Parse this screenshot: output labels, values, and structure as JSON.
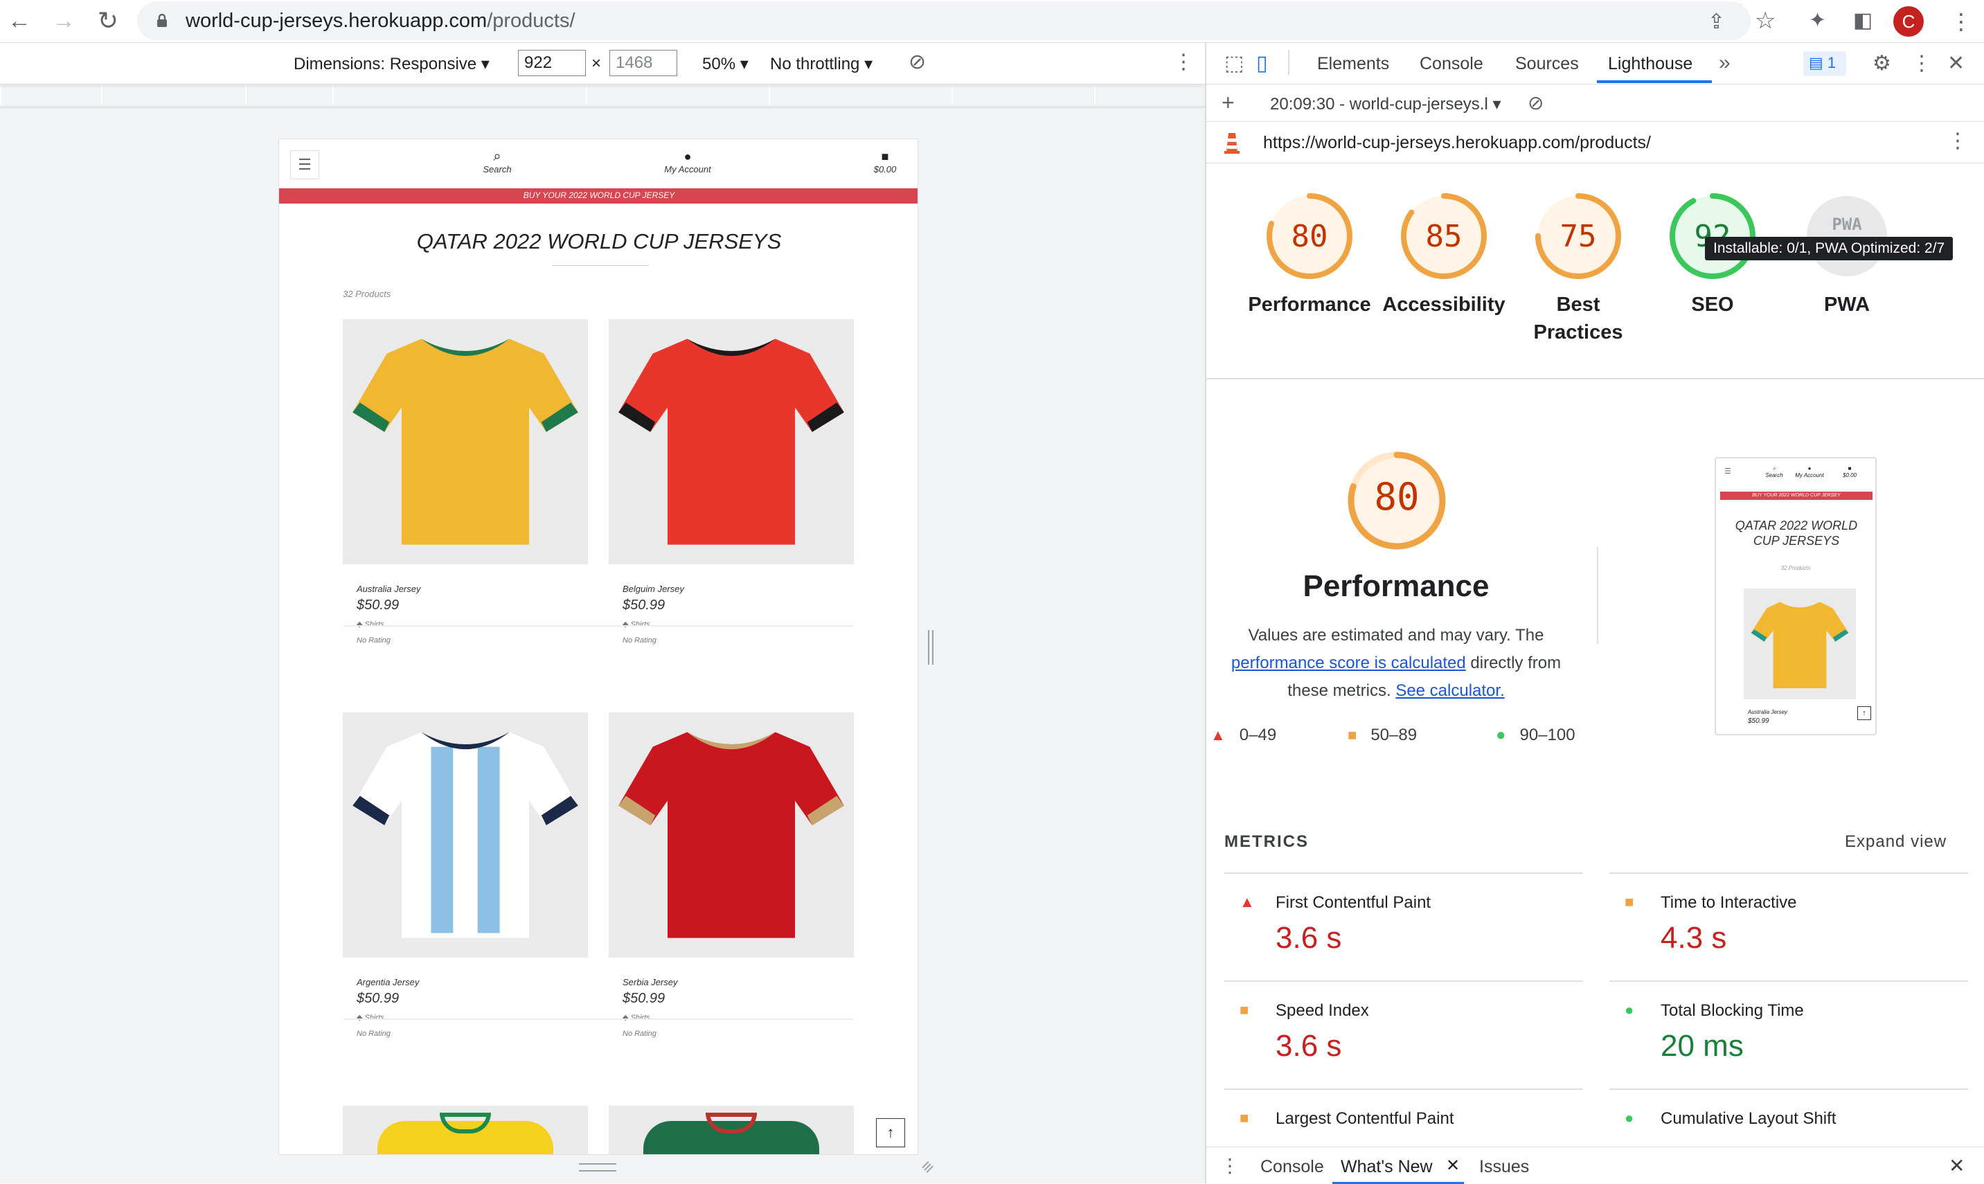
{
  "browser": {
    "url_host": "world-cup-jerseys.herokuapp.com",
    "url_path": "/products/",
    "avatar_letter": "C"
  },
  "device_toolbar": {
    "dimensions_label": "Dimensions: Responsive",
    "width": "922",
    "height": "1468",
    "zoom": "50%",
    "throttling": "No throttling"
  },
  "site": {
    "nav_search": "Search",
    "nav_account": "My Account",
    "nav_cart": "$0.00",
    "banner": "BUY YOUR 2022 WORLD CUP JERSEY",
    "page_title": "QATAR 2022 WORLD CUP JERSEYS",
    "product_count": "32 Products",
    "products": [
      {
        "name": "Australia Jersey",
        "price": "$50.99",
        "tag": "Shirts",
        "rating": "No Rating",
        "colors": [
          "#f2b731",
          "#e9c14a",
          "#1e7a4a"
        ]
      },
      {
        "name": "Belguim Jersey",
        "price": "$50.99",
        "tag": "Shirts",
        "rating": "No Rating",
        "colors": [
          "#e8362c",
          "#d42a22",
          "#1a1a1a"
        ]
      },
      {
        "name": "Argentia Jersey",
        "price": "$50.99",
        "tag": "Shirts",
        "rating": "No Rating",
        "colors": [
          "#ffffff",
          "#8cc0e6",
          "#1c2a4a"
        ]
      },
      {
        "name": "Serbia Jersey",
        "price": "$50.99",
        "tag": "Shirts",
        "rating": "No Rating",
        "colors": [
          "#c8171e",
          "#b11218",
          "#c7a46b"
        ]
      }
    ],
    "brand_banner_color": "#d64550"
  },
  "devtools": {
    "tabs": [
      "Elements",
      "Console",
      "Sources",
      "Lighthouse"
    ],
    "active_tab": "Lighthouse",
    "issues_badge": "1",
    "report_label": "20:09:30 - world-cup-jerseys.l",
    "report_url": "https://world-cup-jerseys.herokuapp.com/products/",
    "tooltip": "Installable: 0/1, PWA Optimized: 2/7",
    "categories": [
      {
        "label": "Performance",
        "score": "80",
        "value": 80
      },
      {
        "label": "Accessibility",
        "score": "85",
        "value": 85
      },
      {
        "label": "Best Practices",
        "score": "75",
        "value": 75
      },
      {
        "label": "SEO",
        "score": "92",
        "value": 92
      },
      {
        "label": "PWA",
        "score": "PWA",
        "value": null
      }
    ],
    "perf": {
      "score": "80",
      "title": "Performance",
      "desc_1": "Values are estimated and may vary. The",
      "desc_link_1": "performance score is calculated",
      "desc_2": "directly from",
      "desc_3": "these metrics.",
      "desc_link_2": "See calculator.",
      "legend": [
        "0–49",
        "50–89",
        "90–100"
      ]
    },
    "thumb": {
      "search": "Search",
      "account": "My Account",
      "cart": "$0.00",
      "banner": "BUY YOUR 2022 WORLD CUP JERSEY",
      "title": "QATAR 2022 WORLD CUP JERSEYS",
      "count": "32 Products",
      "name": "Australia Jersey",
      "price": "$50.99"
    },
    "metrics_heading": "METRICS",
    "expand_view": "Expand view",
    "metrics": [
      {
        "title": "First Contentful Paint",
        "value": "3.6 s",
        "status": "fail"
      },
      {
        "title": "Time to Interactive",
        "value": "4.3 s",
        "status": "average"
      },
      {
        "title": "Speed Index",
        "value": "3.6 s",
        "status": "average"
      },
      {
        "title": "Total Blocking Time",
        "value": "20 ms",
        "status": "pass"
      },
      {
        "title": "Largest Contentful Paint",
        "value": "",
        "status": "average"
      },
      {
        "title": "Cumulative Layout Shift",
        "value": "",
        "status": "pass"
      }
    ],
    "drawer_tabs": [
      "Console",
      "What's New",
      "Issues"
    ],
    "colors": {
      "fail": "#e3382f",
      "average": "#f0a342",
      "pass": "#3cc75d",
      "fail_text": "#c5221f",
      "pass_text": "#188038",
      "link": "#1a56d6",
      "accent": "#1a73e8"
    }
  }
}
